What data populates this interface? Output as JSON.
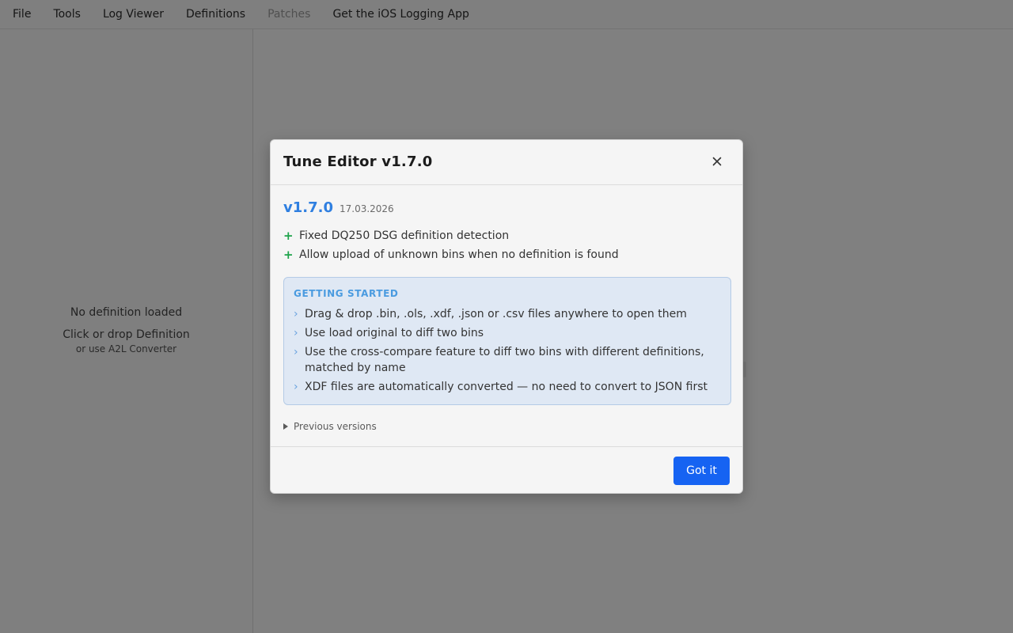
{
  "menubar": {
    "items": [
      {
        "label": "File",
        "disabled": false
      },
      {
        "label": "Tools",
        "disabled": false
      },
      {
        "label": "Log Viewer",
        "disabled": false
      },
      {
        "label": "Definitions",
        "disabled": false
      },
      {
        "label": "Patches",
        "disabled": true
      },
      {
        "label": "Get the iOS Logging App",
        "disabled": false
      }
    ]
  },
  "sidebar": {
    "empty_title": "No definition loaded",
    "drop_text": "Click or drop Definition",
    "a2l_text": "or use A2L Converter"
  },
  "modal": {
    "title": "Tune Editor v1.7.0",
    "version": "v1.7.0",
    "date": "17.03.2026",
    "changes": [
      "Fixed DQ250 DSG definition detection",
      "Allow upload of unknown bins when no definition is found"
    ],
    "getting_started": {
      "title": "GETTING STARTED",
      "items": [
        "Drag & drop .bin, .ols, .xdf, .json or .csv files anywhere to open them",
        "Use load original to diff two bins",
        "Use the cross-compare feature to diff two bins with different definitions, matched by name",
        "XDF files are automatically converted — no need to convert to JSON first"
      ]
    },
    "previous_versions": "Previous versions",
    "confirm_label": "Got it"
  },
  "colors": {
    "accent": "#1663f2",
    "version": "#2f7fe0",
    "plus": "#1ea34a",
    "info_bg": "#dfe8f4"
  }
}
